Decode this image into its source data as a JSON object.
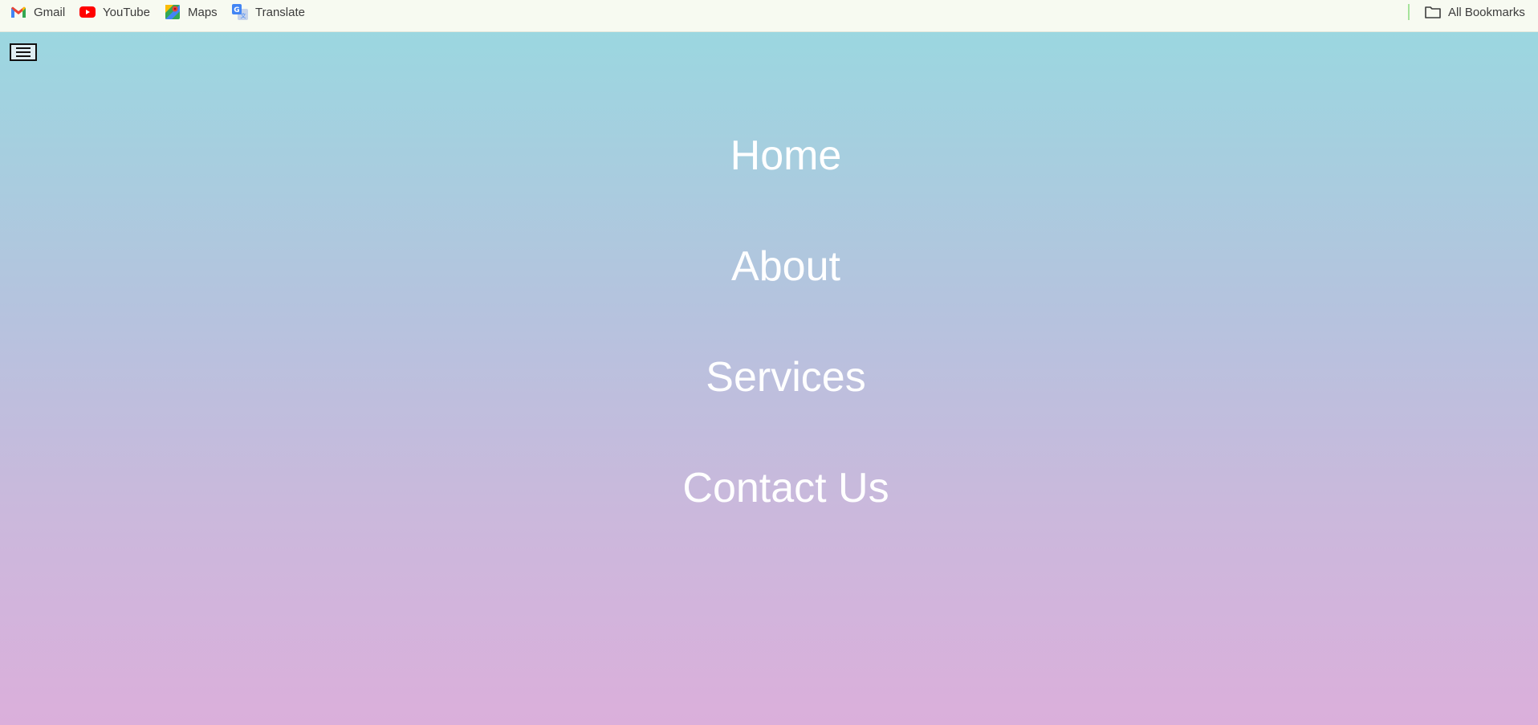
{
  "bookmarks_bar": {
    "items": [
      {
        "label": "Gmail",
        "icon": "gmail-icon"
      },
      {
        "label": "YouTube",
        "icon": "youtube-icon"
      },
      {
        "label": "Maps",
        "icon": "maps-icon"
      },
      {
        "label": "Translate",
        "icon": "translate-icon"
      }
    ],
    "all_bookmarks": {
      "label": "All Bookmarks",
      "icon": "folder-icon"
    }
  },
  "page": {
    "menu_toggle_icon": "hamburger-menu-icon",
    "nav": {
      "items": [
        {
          "label": "Home"
        },
        {
          "label": "About"
        },
        {
          "label": "Services"
        },
        {
          "label": "Contact Us"
        }
      ]
    },
    "colors": {
      "gradient_top": "#9bd7e0",
      "gradient_bottom": "#dbafdb",
      "nav_text": "#ffffff"
    }
  }
}
